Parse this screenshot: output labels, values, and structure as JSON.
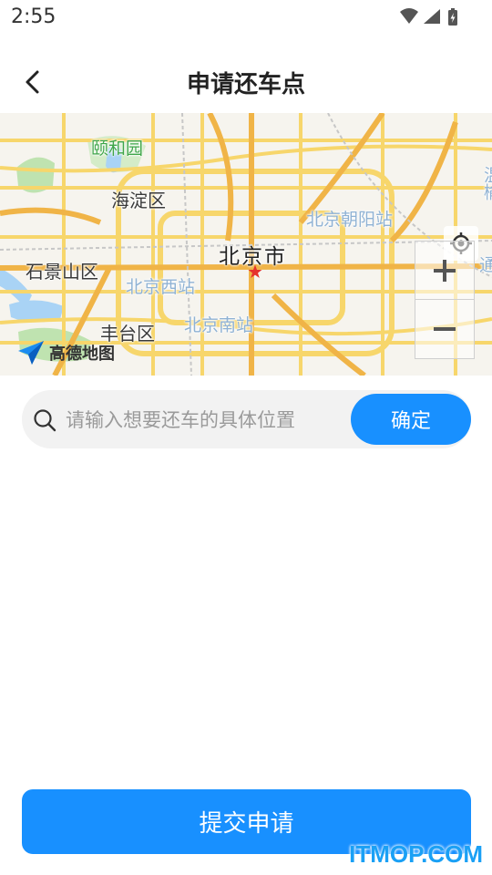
{
  "status_bar": {
    "time": "2:55",
    "icons": [
      "wifi-icon",
      "signal-icon",
      "battery-charging-icon"
    ]
  },
  "nav": {
    "back_icon": "chevron-left-icon",
    "title": "申请还车点"
  },
  "map": {
    "labels": {
      "yiheyuan": "颐和园",
      "haidian": "海淀区",
      "chaoyang_station": "北京朝阳站",
      "beijing": "北京市",
      "shijingshan": "石景山区",
      "west_station": "北京西站",
      "south_station": "北京南站",
      "fengtai": "丰台区",
      "edge_right": "温榆",
      "edge_right_2": "通"
    },
    "logo_text": "高德地图",
    "controls": {
      "locate_icon": "crosshair-icon",
      "zoom_in_icon": "plus-icon",
      "zoom_out_icon": "minus-icon"
    },
    "colors": {
      "road": "#f7d66b",
      "major_road": "#f0b447",
      "water": "#a9d3f5",
      "green": "#bfe3b0",
      "background": "#f6f4ee"
    }
  },
  "search": {
    "icon": "search-icon",
    "value": "",
    "placeholder": "请输入想要还车的具体位置",
    "confirm_label": "确定"
  },
  "footer": {
    "submit_label": "提交申请",
    "watermark": "ITMOP.COM"
  },
  "colors": {
    "accent": "#1890ff",
    "search_bg": "#f2f2f2"
  }
}
